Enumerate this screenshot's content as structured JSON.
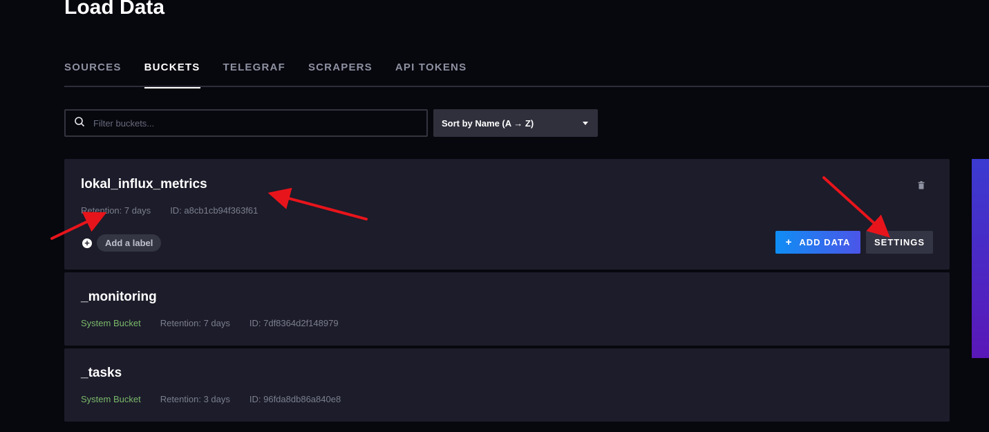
{
  "page": {
    "title": "Load Data"
  },
  "tabs": [
    {
      "label": "SOURCES",
      "active": false
    },
    {
      "label": "BUCKETS",
      "active": true
    },
    {
      "label": "TELEGRAF",
      "active": false
    },
    {
      "label": "SCRAPERS",
      "active": false
    },
    {
      "label": "API TOKENS",
      "active": false
    }
  ],
  "search": {
    "placeholder": "Filter buckets...",
    "value": ""
  },
  "sort": {
    "selected": "Sort by Name (A → Z)"
  },
  "buckets": [
    {
      "name": "lokal_influx_metrics",
      "retention": "Retention: 7 days",
      "id": "ID: a8cb1cb94f363f61",
      "add_label": "Add a label",
      "add_data": "ADD DATA",
      "settings": "SETTINGS"
    },
    {
      "name": "_monitoring",
      "system": "System Bucket",
      "retention": "Retention: 7 days",
      "id": "ID: 7df8364d2f148979"
    },
    {
      "name": "_tasks",
      "system": "System Bucket",
      "retention": "Retention: 3 days",
      "id": "ID: 96fda8db86a840e8"
    }
  ],
  "colors": {
    "accent_gradient_start": "#0f8ef4",
    "accent_gradient_end": "#4b55e8",
    "system_bucket": "#7bb86a",
    "annotation_arrow": "#e8141b"
  },
  "icons": [
    "search-icon",
    "caret-down-icon",
    "plus-icon",
    "trash-icon"
  ]
}
